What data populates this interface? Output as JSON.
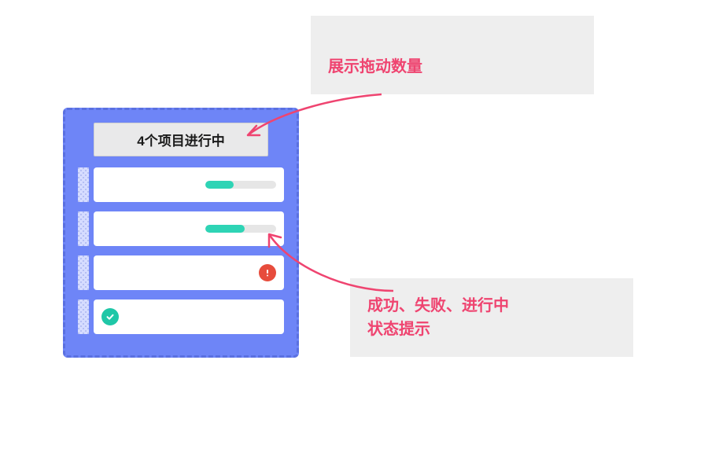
{
  "panel": {
    "header": "4个项目进行中",
    "items": [
      {
        "type": "progress",
        "percent": 40
      },
      {
        "type": "progress",
        "percent": 55
      },
      {
        "type": "error"
      },
      {
        "type": "success"
      }
    ]
  },
  "callouts": {
    "top": "展示拖动数量",
    "bottom": "成功、失败、进行中\n状态提示"
  },
  "colors": {
    "panel_bg": "#6e85f7",
    "accent_pink": "#ef4470",
    "progress_fill": "#2ed4b5",
    "error": "#e74c3c",
    "success": "#1fc7a7"
  }
}
